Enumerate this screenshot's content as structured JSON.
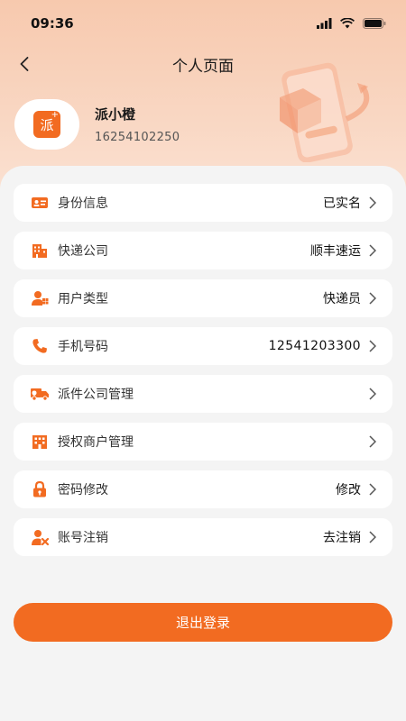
{
  "status_bar": {
    "time": "09:36"
  },
  "nav": {
    "title": "个人页面"
  },
  "profile": {
    "name": "派小橙",
    "phone": "16254102250",
    "logo_char": "派"
  },
  "menu": [
    {
      "label": "身份信息",
      "value": "已实名",
      "icon": "id-card-icon"
    },
    {
      "label": "快递公司",
      "value": "顺丰速运",
      "icon": "building-icon"
    },
    {
      "label": "用户类型",
      "value": "快递员",
      "icon": "user-type-icon"
    },
    {
      "label": "手机号码",
      "value": "12541203300",
      "icon": "phone-icon"
    },
    {
      "label": "派件公司管理",
      "value": "",
      "icon": "delivery-truck-icon"
    },
    {
      "label": "授权商户管理",
      "value": "",
      "icon": "merchant-building-icon"
    },
    {
      "label": "密码修改",
      "value": "修改",
      "icon": "lock-icon"
    },
    {
      "label": "账号注销",
      "value": "去注销",
      "icon": "user-remove-icon"
    }
  ],
  "logout": {
    "label": "退出登录"
  },
  "colors": {
    "accent": "#f26b21",
    "header_top": "#f7c9ae",
    "background": "#f4f4f4"
  }
}
